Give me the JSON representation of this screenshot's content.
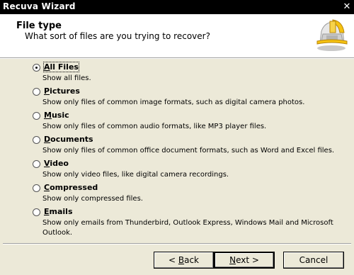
{
  "window": {
    "title": "Recuva Wizard",
    "close_glyph": "✕"
  },
  "header": {
    "title": "File type",
    "subtitle": "What sort of files are you trying to recover?",
    "logo_icon": "recuva-helmet-icon"
  },
  "options": [
    {
      "key": "A",
      "rest": "ll Files",
      "description": "Show all files.",
      "checked": true
    },
    {
      "key": "P",
      "rest": "ictures",
      "description": "Show only files of common image formats, such as digital camera photos.",
      "checked": false
    },
    {
      "key": "M",
      "rest": "usic",
      "description": "Show only files of common audio formats, like MP3 player files.",
      "checked": false
    },
    {
      "key": "D",
      "rest": "ocuments",
      "description": "Show only files of common office document formats, such as Word and Excel files.",
      "checked": false
    },
    {
      "key": "V",
      "rest": "ideo",
      "description": "Show only video files, like digital camera recordings.",
      "checked": false
    },
    {
      "key": "C",
      "rest": "ompressed",
      "description": "Show only compressed files.",
      "checked": false
    },
    {
      "key": "E",
      "rest": "mails",
      "description": "Show only emails from Thunderbird, Outlook Express, Windows Mail and Microsoft Outlook.",
      "checked": false
    }
  ],
  "buttons": {
    "back_prefix": "< ",
    "back_key": "B",
    "back_rest": "ack",
    "next_key": "N",
    "next_rest": "ext >",
    "cancel_label": "Cancel"
  }
}
